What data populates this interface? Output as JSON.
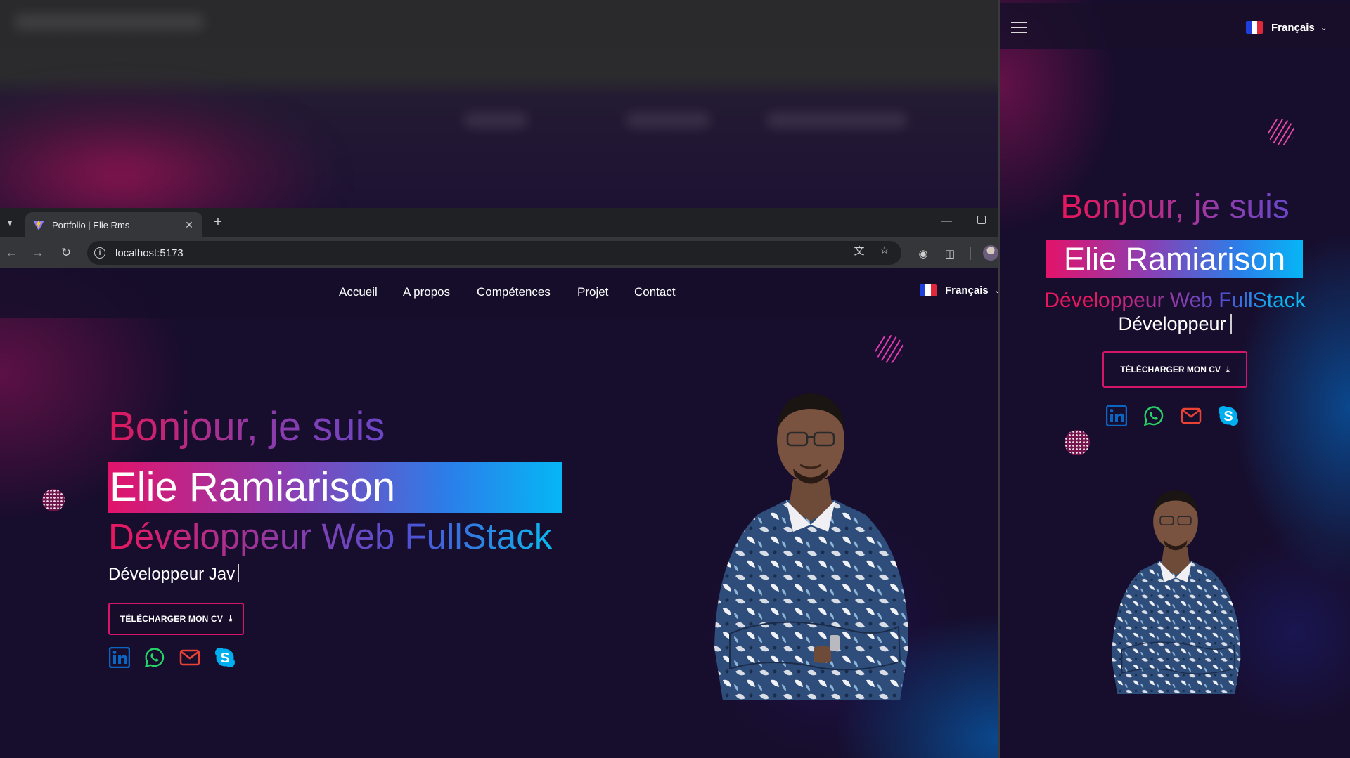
{
  "browser": {
    "tab_title": "Portfolio | Elie Rms",
    "url": "localhost:5173"
  },
  "nav": {
    "items": [
      "Accueil",
      "A propos",
      "Compétences",
      "Projet",
      "Contact"
    ],
    "language": "Français"
  },
  "hero": {
    "greeting": "Bonjour, je suis",
    "name": "Elie Ramiarison",
    "role": "Développeur Web FullStack",
    "typing_text": "Développeur Jav",
    "cv_button": "TÉLÉCHARGER MON CV",
    "socials": [
      "linkedin-icon",
      "whatsapp-icon",
      "mail-icon",
      "skype-icon"
    ]
  },
  "mobile": {
    "language": "Français",
    "greeting": "Bonjour, je suis",
    "name": "Elie Ramiarison",
    "role": "Développeur Web FullStack",
    "typing_text": "Développeur",
    "cv_button": "TÉLÉCHARGER MON CV"
  },
  "colors": {
    "accent_pink": "#e2136a",
    "accent_blue": "#06b6f5",
    "background": "#170d2c",
    "linkedin": "#0a66c2",
    "whatsapp": "#25d366",
    "mail": "#ea4335",
    "skype": "#00aff0"
  }
}
